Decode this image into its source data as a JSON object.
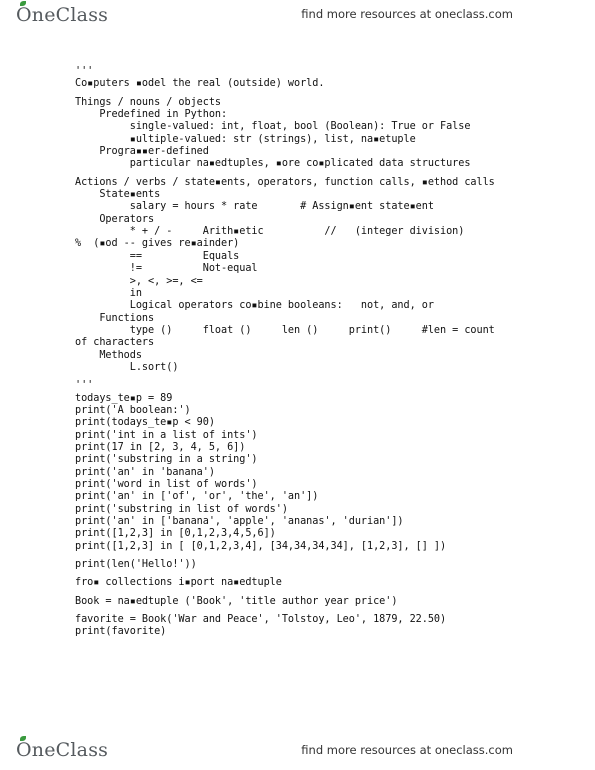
{
  "header": {
    "logo_first": "O",
    "logo_rest": "neClass",
    "tagline": "find more resources at oneclass.com"
  },
  "footer": {
    "logo_first": "O",
    "logo_rest": "neClass",
    "tagline": "find more resources at oneclass.com"
  },
  "document": {
    "lines": [
      "'''",
      "Co▪puters ▪odel the real (outside) world.",
      "",
      "Things / nouns / objects",
      "    Predefined in Python:",
      "         single-valued: int, float, bool (Boolean): True or False",
      "         ▪ultiple-valued: str (strings), list, na▪etuple",
      "    Progra▪▪er-defined",
      "         particular na▪edtuples, ▪ore co▪plicated data structures",
      "",
      "Actions / verbs / state▪ents, operators, function calls, ▪ethod calls",
      "    State▪ents",
      "         salary = hours * rate       # Assign▪ent state▪ent",
      "    Operators",
      "         * + / -     Arith▪etic          //   (integer division)",
      "%  (▪od -- gives re▪ainder)",
      "         ==          Equals",
      "         !=          Not-equal",
      "         >, <, >=, <=",
      "         in",
      "         Logical operators co▪bine booleans:   not, and, or",
      "    Functions",
      "         type ()     float ()     len ()     print()     #len = count",
      "of characters",
      "    Methods",
      "         L.sort()",
      "",
      "'''",
      "todays_te▪p = 89",
      "print('A boolean:')",
      "print(todays_te▪p < 90)",
      "print('int in a list of ints')",
      "print(17 in [2, 3, 4, 5, 6])",
      "print('substring in a string')",
      "print('an' in 'banana')",
      "print('word in list of words')",
      "print('an' in ['of', 'or', 'the', 'an'])",
      "print('substring in list of words')",
      "print('an' in ['banana', 'apple', 'ananas', 'durian'])",
      "print([1,2,3] in [0,1,2,3,4,5,6])",
      "print([1,2,3] in [ [0,1,2,3,4], [34,34,34,34], [1,2,3], [] ])",
      "",
      "print(len('Hello!'))",
      "",
      "fro▪ collections i▪port na▪edtuple",
      "",
      "Book = na▪edtuple ('Book', 'title author year price')",
      "",
      "favorite = Book('War and Peace', 'Tolstoy, Leo', 1879, 22.50)",
      "print(favorite)"
    ]
  }
}
